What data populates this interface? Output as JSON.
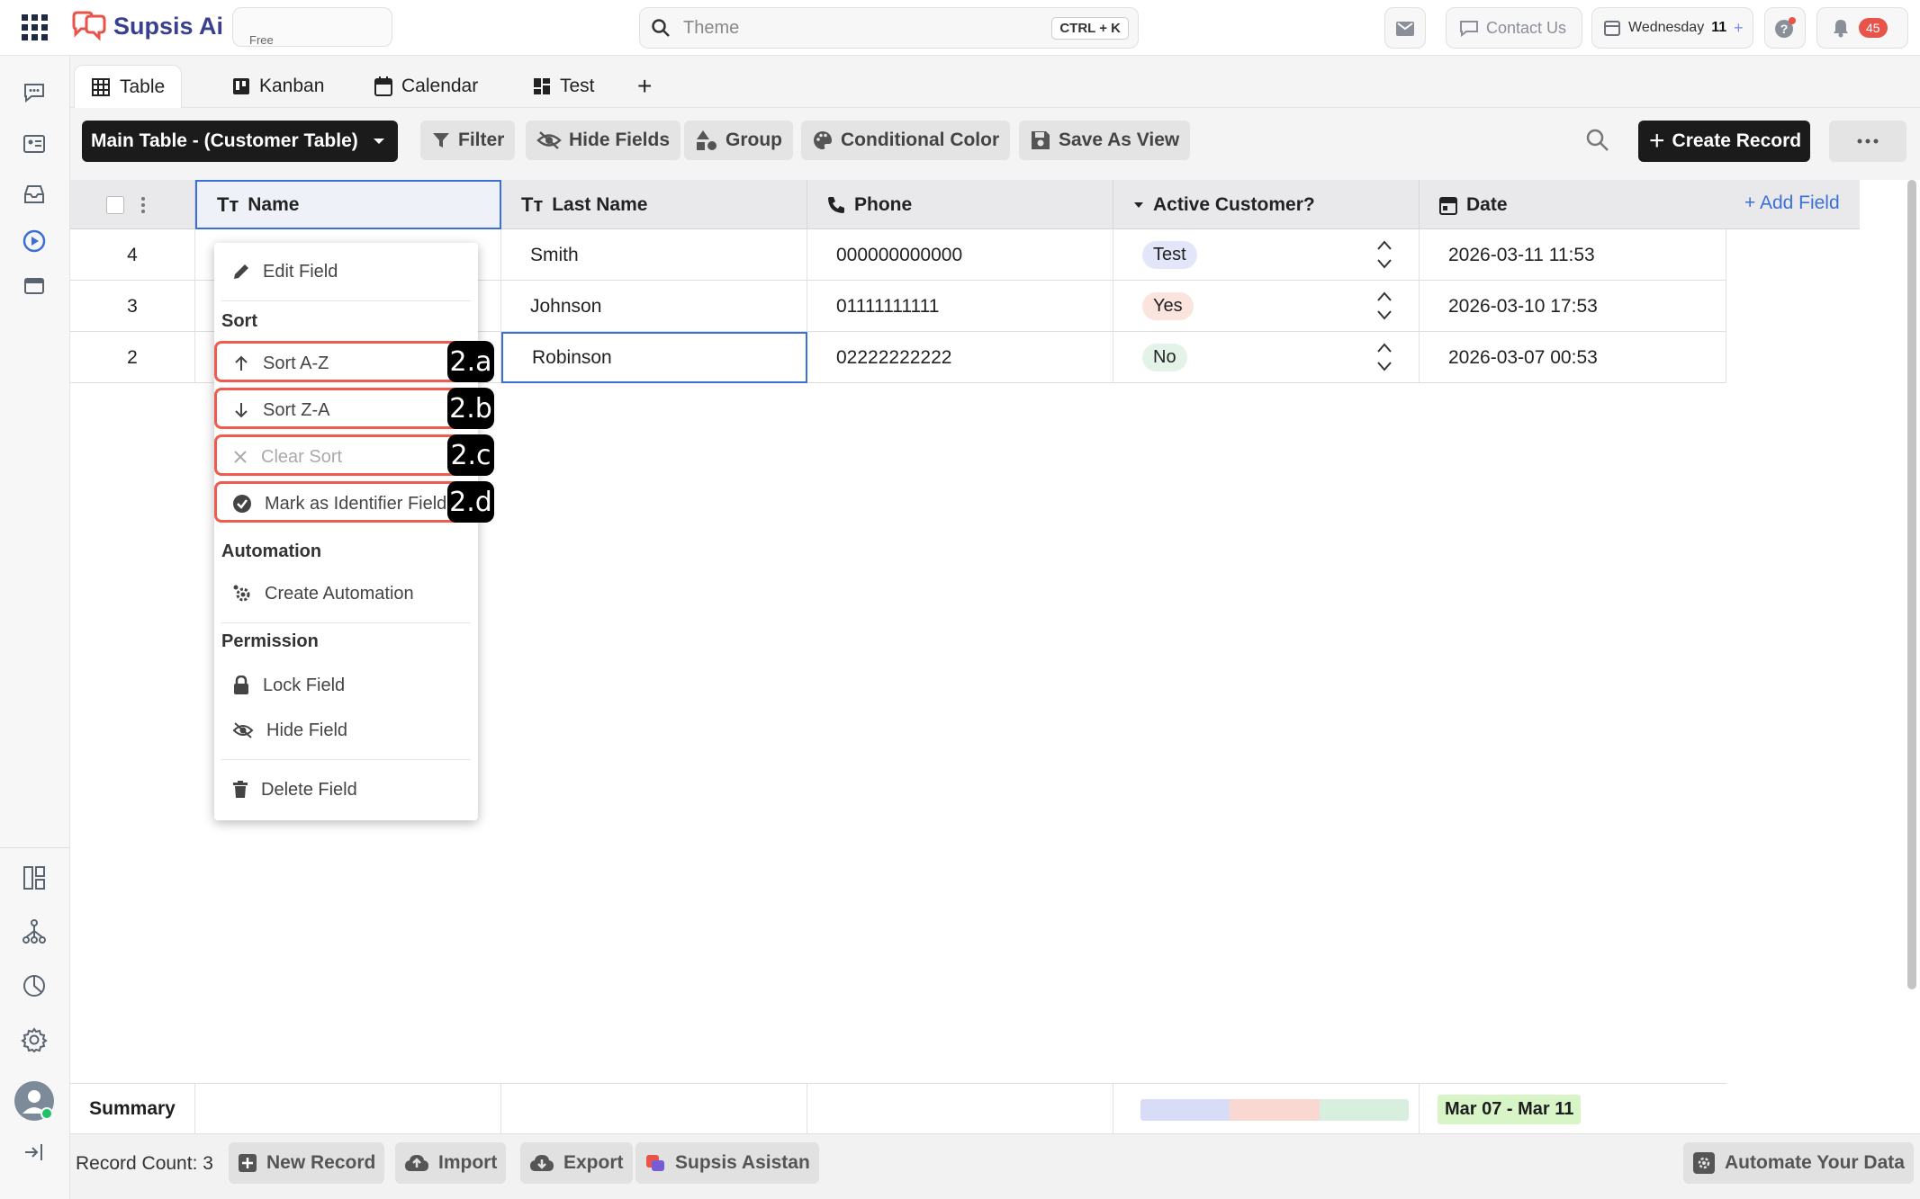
{
  "app": {
    "brand": "Supsis Ai",
    "plan": "Free",
    "search_placeholder": "Theme",
    "search_shortcut": "CTRL + K",
    "contact_label": "Contact Us",
    "date_label": "Wednesday",
    "date_day": "11",
    "notification_count": "45"
  },
  "tabs": [
    {
      "label": "Table",
      "icon": "table-icon",
      "active": true
    },
    {
      "label": "Kanban",
      "icon": "kanban-icon"
    },
    {
      "label": "Calendar",
      "icon": "calendar-icon"
    },
    {
      "label": "Test",
      "icon": "dashboard-icon"
    }
  ],
  "toolbar": {
    "table_select": "Main Table - (Customer Table)",
    "filter": "Filter",
    "hide_fields": "Hide Fields",
    "group": "Group",
    "conditional_color": "Conditional Color",
    "save_as_view": "Save As View",
    "create_record": "Create Record"
  },
  "columns": {
    "name": "Name",
    "last_name": "Last Name",
    "phone": "Phone",
    "active": "Active Customer?",
    "date": "Date",
    "add_field": "+ Add Field"
  },
  "rows": [
    {
      "id": "4",
      "last_name": "Smith",
      "phone": "000000000000",
      "active": "Test",
      "date": "2026-03-11 11:53"
    },
    {
      "id": "3",
      "last_name": "Johnson",
      "phone": "01111111111",
      "active": "Yes",
      "date": "2026-03-10 17:53"
    },
    {
      "id": "2",
      "last_name": "Robinson",
      "phone": "02222222222",
      "active": "No",
      "date": "2026-03-07 00:53"
    }
  ],
  "menu": {
    "edit_field": "Edit Field",
    "sort_section": "Sort",
    "sort_az": "Sort A-Z",
    "sort_za": "Sort Z-A",
    "clear_sort": "Clear Sort",
    "mark_identifier": "Mark as Identifier Field",
    "automation_section": "Automation",
    "create_automation": "Create Automation",
    "permission_section": "Permission",
    "lock_field": "Lock Field",
    "hide_field": "Hide Field",
    "delete_field": "Delete Field"
  },
  "annotations": [
    "2.a",
    "2.b",
    "2.c",
    "2.d"
  ],
  "summary": {
    "label": "Summary",
    "date_range": "Mar 07 - Mar 11"
  },
  "footer": {
    "record_count": "Record Count: 3",
    "new_record": "New Record",
    "import": "Import",
    "export": "Export",
    "assistant": "Supsis Asistan",
    "automate": "Automate Your Data"
  },
  "colors": {
    "badge_test": "#e3e6f8",
    "badge_yes": "#fbe3de",
    "badge_no": "#e3f3e8",
    "highlight": "#f05a4f",
    "brand": "#e8534a",
    "date_range_bg": "#d8f5c8"
  }
}
